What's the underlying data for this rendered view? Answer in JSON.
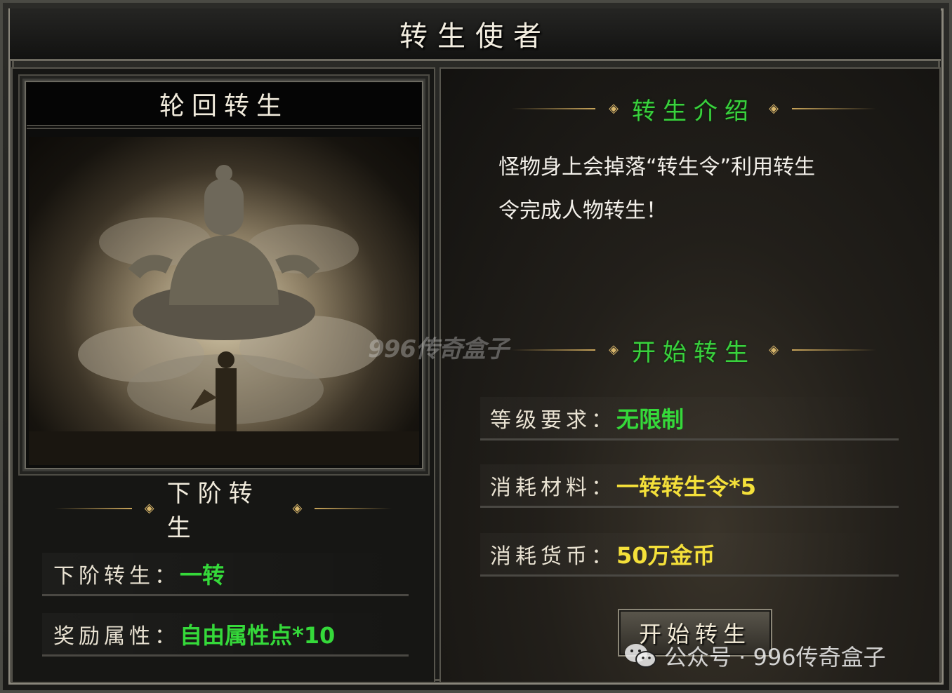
{
  "window": {
    "title": "转生使者"
  },
  "left": {
    "image_title": "轮回转生",
    "next_section": "下阶转生",
    "rows": [
      {
        "label": "下阶转生：",
        "value": "一转"
      },
      {
        "label": "奖励属性：",
        "value": "自由属性点*10"
      }
    ]
  },
  "right": {
    "intro_title": "转生介绍",
    "intro_line1": "怪物身上会掉落“转生令”利用转生",
    "intro_line2": "令完成人物转生！",
    "start_title": "开始转生",
    "rows": [
      {
        "label": "等级要求：",
        "value": "无限制"
      },
      {
        "label": "消耗材料：",
        "value": "一转转生令*5"
      },
      {
        "label": "消耗货币：",
        "value": "50万金币"
      }
    ],
    "start_button": "开始转生"
  },
  "watermark": "996传奇盒子",
  "footer": "公众号 · 996传奇盒子",
  "colors": {
    "green": "#39d23d",
    "yellow": "#f4e03a",
    "gold": "#c8a45a"
  }
}
